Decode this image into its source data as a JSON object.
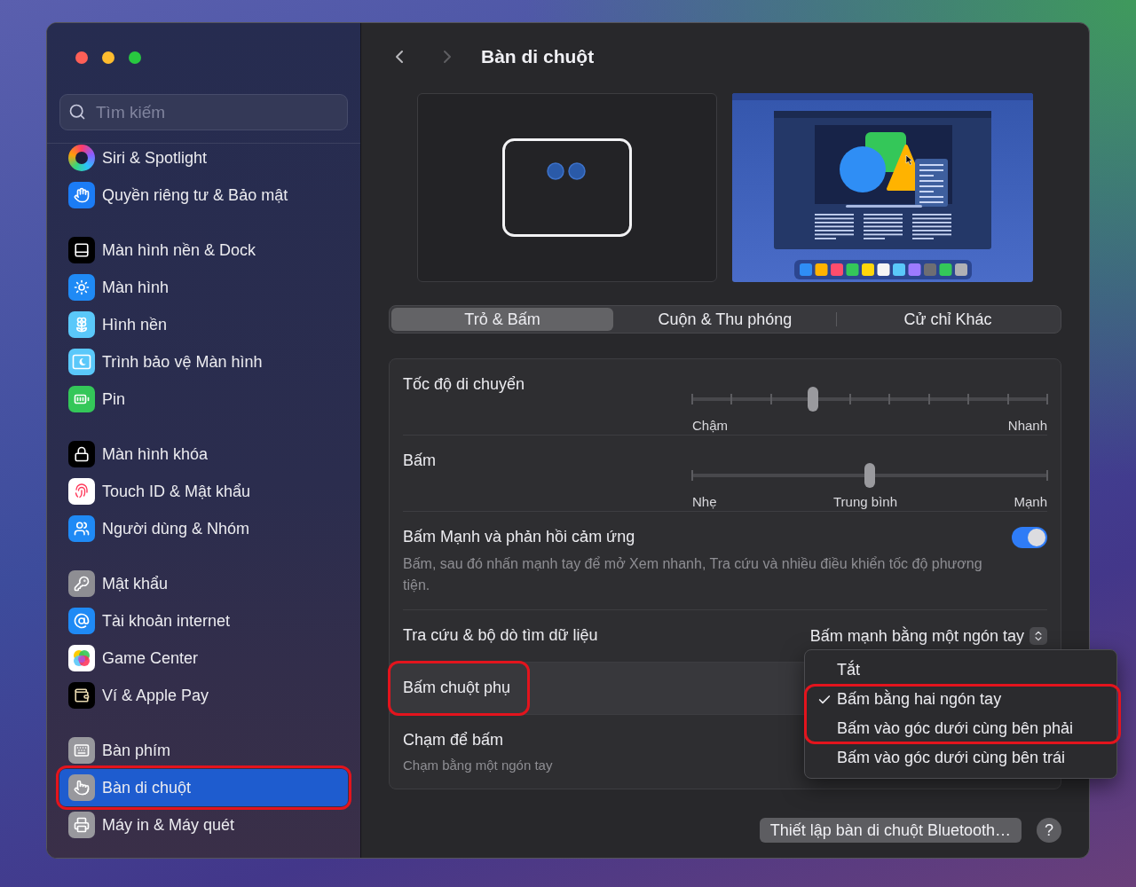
{
  "sidebar": {
    "search": {
      "placeholder": "Tìm kiếm"
    },
    "groups": [
      {
        "items": [
          {
            "label": "Siri & Spotlight",
            "selected": false,
            "highlighted": false
          },
          {
            "label": "Quyền riêng tư & Bảo mật",
            "selected": false,
            "highlighted": false
          }
        ]
      },
      {
        "items": [
          {
            "label": "Màn hình nền & Dock",
            "selected": false,
            "highlighted": false
          },
          {
            "label": "Màn hình",
            "selected": false,
            "highlighted": false
          },
          {
            "label": "Hình nền",
            "selected": false,
            "highlighted": false
          },
          {
            "label": "Trình bảo vệ Màn hình",
            "selected": false,
            "highlighted": false
          },
          {
            "label": "Pin",
            "selected": false,
            "highlighted": false
          }
        ]
      },
      {
        "items": [
          {
            "label": "Màn hình khóa",
            "selected": false,
            "highlighted": false
          },
          {
            "label": "Touch ID & Mật khẩu",
            "selected": false,
            "highlighted": false
          },
          {
            "label": "Người dùng & Nhóm",
            "selected": false,
            "highlighted": false
          }
        ]
      },
      {
        "items": [
          {
            "label": "Mật khẩu",
            "selected": false,
            "highlighted": false
          },
          {
            "label": "Tài khoản internet",
            "selected": false,
            "highlighted": false
          },
          {
            "label": "Game Center",
            "selected": false,
            "highlighted": false
          },
          {
            "label": "Ví & Apple Pay",
            "selected": false,
            "highlighted": false
          }
        ]
      },
      {
        "items": [
          {
            "label": "Bàn phím",
            "selected": false,
            "highlighted": false
          },
          {
            "label": "Bàn di chuột",
            "selected": true,
            "highlighted": true
          },
          {
            "label": "Máy in & Máy quét",
            "selected": false,
            "highlighted": false
          }
        ]
      }
    ]
  },
  "header": {
    "title": "Bàn di chuột",
    "back": {
      "disabled": false
    },
    "forward": {
      "disabled": true
    }
  },
  "tabs": [
    {
      "label": "Trỏ & Bấm",
      "selected": true
    },
    {
      "label": "Cuộn & Thu phóng",
      "selected": false
    },
    {
      "label": "Cử chỉ Khác",
      "selected": false
    }
  ],
  "settings": [
    {
      "kind": "slider",
      "label": "Tốc độ di chuyển",
      "level": 0.34,
      "scale": [
        "Chậm",
        "Nhanh"
      ],
      "highlighted": false
    },
    {
      "kind": "slider",
      "label": "Bấm",
      "level": 0.5,
      "scale": [
        "Nhẹ",
        "Trung bình",
        "Mạnh"
      ],
      "highlighted": false
    },
    {
      "kind": "toggle",
      "label": "Bấm Mạnh và phản hồi cảm ứng",
      "description": "Bấm, sau đó nhấn mạnh tay để mở Xem nhanh, Tra cứu và nhiều điều khiển tốc độ phương tiện.",
      "on": true,
      "highlighted": false
    },
    {
      "kind": "popup",
      "label": "Tra cứu & bộ dò tìm dữ liệu",
      "value": "Bấm mạnh bằng một ngón tay",
      "menu_open": false,
      "highlighted": false
    },
    {
      "kind": "popup",
      "label": "Bấm chuột phụ",
      "menu_open": true,
      "highlighted": true,
      "menu": {
        "options": [
          {
            "label": "Tắt",
            "selected": false,
            "highlighted": false
          },
          {
            "label": "Bấm bằng hai ngón tay",
            "selected": true,
            "highlighted": true
          },
          {
            "label": "Bấm vào góc dưới cùng bên phải",
            "selected": false,
            "highlighted": true
          },
          {
            "label": "Bấm vào góc dưới cùng bên trái",
            "selected": false,
            "highlighted": false
          }
        ]
      }
    },
    {
      "kind": "text",
      "label": "Chạm để bấm",
      "description": "Chạm bằng một ngón tay",
      "highlighted": false
    }
  ],
  "footer": {
    "button": "Thiết lập bàn di chuột Bluetooth…",
    "help": "?"
  }
}
